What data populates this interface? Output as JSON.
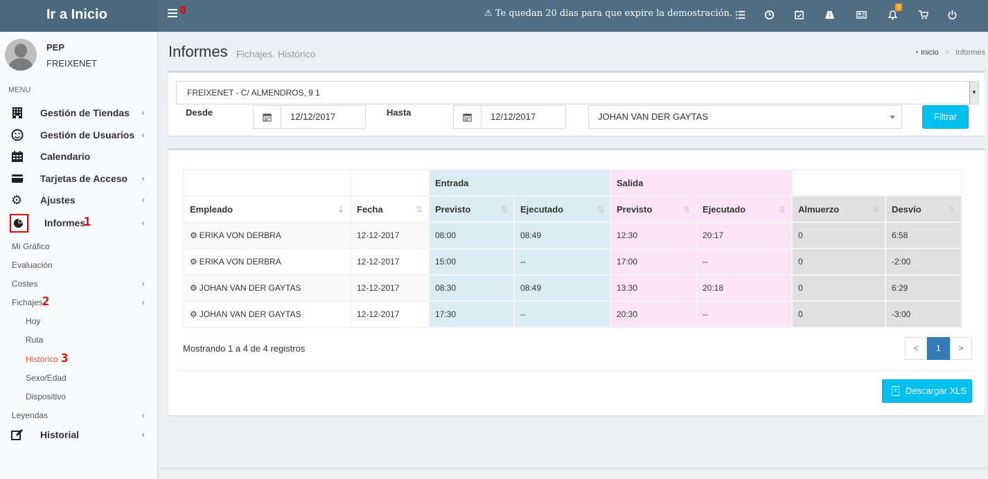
{
  "topbar": {
    "brand": "Ir a Inicio",
    "annotation_0": "0",
    "demo_notice": "Te quedan 20 dias para que expire la demostración.",
    "notification_count": "0",
    "icons": [
      "list-icon",
      "clock-icon",
      "calendar-check-icon",
      "road-icon",
      "newspaper-icon",
      "bell-icon",
      "cart-icon",
      "power-icon"
    ]
  },
  "user": {
    "first": "PEP",
    "last": "FREIXENET"
  },
  "sidebar": {
    "menu_label": "MENU",
    "items": [
      {
        "label": "Gestión de Tiendas",
        "icon": "building-icon"
      },
      {
        "label": "Gestión de Usuarios",
        "icon": "smile-icon"
      },
      {
        "label": "Calendario",
        "icon": "calendar-icon"
      },
      {
        "label": "Tarjetas de Acceso",
        "icon": "credit-card-icon"
      },
      {
        "label": "Ajustes",
        "icon": "gear-icon"
      },
      {
        "label": "Informes",
        "icon": "pie-chart-icon",
        "annotation": "1"
      },
      {
        "label": "Historial",
        "icon": "edit-icon"
      }
    ],
    "informes_sub": [
      {
        "label": "Mi Gráfico"
      },
      {
        "label": "Evaluación"
      },
      {
        "label": "Costes"
      },
      {
        "label": "Fichajes",
        "annotation": "2"
      },
      {
        "label": "Leyendas"
      }
    ],
    "fichajes_sub": [
      {
        "label": "Hoy"
      },
      {
        "label": "Ruta"
      },
      {
        "label": "Histórico",
        "annotation": "3"
      },
      {
        "label": "Sexo/Edad"
      },
      {
        "label": "Dispositivo"
      }
    ]
  },
  "page": {
    "title": "Informes",
    "subtitle": "Fichajes. Histórico",
    "breadcrumb": {
      "home": "Inicio",
      "separator": ">",
      "current": "Informes"
    }
  },
  "filters": {
    "shop": "FREIXENET - C/ ALMENDROS, 9 1",
    "desde_label": "Desde",
    "desde_value": "12/12/2017",
    "hasta_label": "Hasta",
    "hasta_value": "12/12/2017",
    "employee": "JOHAN VAN DER GAYTAS",
    "filter_button": "Filtrar"
  },
  "table": {
    "group_entrada": "Entrada",
    "group_salida": "Salida",
    "headers": {
      "empleado": "Empleado",
      "fecha": "Fecha",
      "previsto_in": "Previsto",
      "ejecutado_in": "Ejecutado",
      "previsto_out": "Previsto",
      "ejecutado_out": "Ejecutado",
      "almuerzo": "Almuerzo",
      "desvio": "Desvío"
    },
    "rows": [
      {
        "empleado": "ERIKA VON DERBRA",
        "fecha": "12-12-2017",
        "previsto_in": "08:00",
        "ejecutado_in": "08:49",
        "previsto_out": "12:30",
        "ejecutado_out": "20:17",
        "almuerzo": "0",
        "desvio": "6:58"
      },
      {
        "empleado": "ERIKA VON DERBRA",
        "fecha": "12-12-2017",
        "previsto_in": "15:00",
        "ejecutado_in": "--",
        "previsto_out": "17:00",
        "ejecutado_out": "--",
        "almuerzo": "0",
        "desvio": "-2:00"
      },
      {
        "empleado": "JOHAN VAN DER GAYTAS",
        "fecha": "12-12-2017",
        "previsto_in": "08:30",
        "ejecutado_in": "08:49",
        "previsto_out": "13:30",
        "ejecutado_out": "20:18",
        "almuerzo": "0",
        "desvio": "6:29"
      },
      {
        "empleado": "JOHAN VAN DER GAYTAS",
        "fecha": "12-12-2017",
        "previsto_in": "17:30",
        "ejecutado_in": "--",
        "previsto_out": "20:30",
        "ejecutado_out": "--",
        "almuerzo": "0",
        "desvio": "-3:00"
      }
    ],
    "showing": "Mostrando 1 a 4 de 4 registros"
  },
  "pagination": {
    "prev": "<",
    "current": "1",
    "next": ">"
  },
  "download_button": "Descargar XLS",
  "colors": {
    "topbar": "#4f6e84",
    "accent": "#00c0ef",
    "active_link": "#e8593b",
    "entrada": "#d9ecf2",
    "salida": "#fde5f7"
  }
}
